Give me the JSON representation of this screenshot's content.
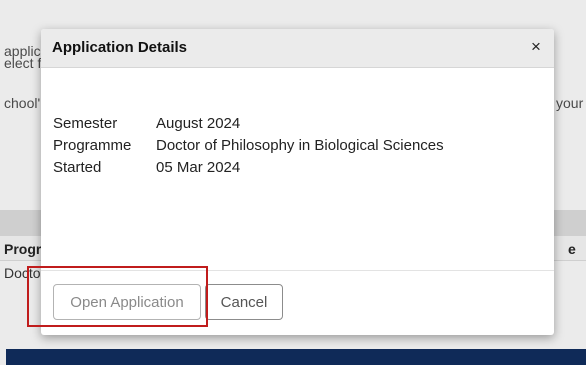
{
  "background": {
    "text_lines": [
      "applic",
      "elect f",
      "chool'",
      "your"
    ],
    "table_columns": [
      "Progr",
      "e"
    ],
    "table_cells": [
      "Docto"
    ]
  },
  "modal": {
    "title": "Application Details",
    "close_symbol": "×",
    "details": [
      {
        "label": "Semester",
        "value": "August 2024"
      },
      {
        "label": "Programme",
        "value": "Doctor of Philosophy in Biological Sciences"
      },
      {
        "label": "Started",
        "value": "05 Mar 2024"
      }
    ],
    "buttons": {
      "open_label": "Open Application",
      "cancel_label": "Cancel"
    }
  },
  "colors": {
    "footer_bar": "#0f2a58",
    "highlight": "#c01c1c"
  }
}
